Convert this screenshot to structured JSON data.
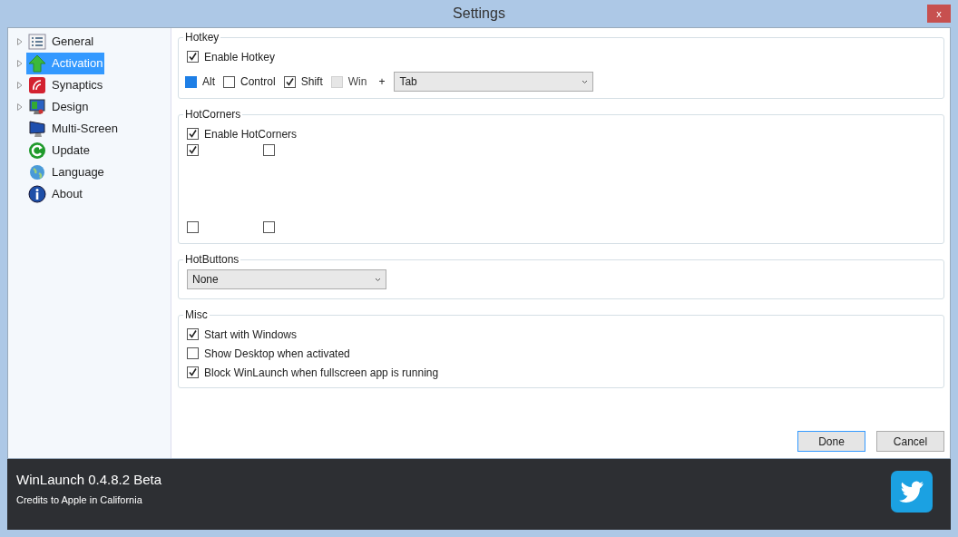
{
  "window": {
    "title": "Settings",
    "close": "x"
  },
  "sidebar": {
    "items": [
      {
        "label": "General",
        "expandable": true,
        "selected": false
      },
      {
        "label": "Activation",
        "expandable": true,
        "selected": true
      },
      {
        "label": "Synaptics",
        "expandable": true,
        "selected": false
      },
      {
        "label": "Design",
        "expandable": true,
        "selected": false
      },
      {
        "label": "Multi-Screen",
        "expandable": false,
        "selected": false
      },
      {
        "label": "Update",
        "expandable": false,
        "selected": false
      },
      {
        "label": "Language",
        "expandable": false,
        "selected": false
      },
      {
        "label": "About",
        "expandable": false,
        "selected": false
      }
    ]
  },
  "hotkey": {
    "title": "Hotkey",
    "enable": {
      "label": "Enable Hotkey",
      "checked": true
    },
    "modifiers": [
      {
        "label": "Alt",
        "checked": false,
        "kind": "highlighted"
      },
      {
        "label": "Control",
        "checked": false,
        "kind": "plain"
      },
      {
        "label": "Shift",
        "checked": true,
        "kind": "plain"
      },
      {
        "label": "Win",
        "checked": false,
        "kind": "disabled"
      }
    ],
    "plus": "+",
    "key": "Tab"
  },
  "hotcorners": {
    "title": "HotCorners",
    "enable": {
      "label": "Enable HotCorners",
      "checked": true
    },
    "corners": [
      {
        "checked": true
      },
      {
        "checked": false
      },
      {
        "checked": false
      },
      {
        "checked": false
      }
    ]
  },
  "hotbuttons": {
    "title": "HotButtons",
    "value": "None"
  },
  "misc": {
    "title": "Misc",
    "options": [
      {
        "label": "Start with Windows",
        "checked": true
      },
      {
        "label": "Show Desktop when activated",
        "checked": false
      },
      {
        "label": "Block WinLaunch when fullscreen app is running",
        "checked": true
      }
    ]
  },
  "buttons": [
    {
      "label": "Done",
      "default": true
    },
    {
      "label": "Cancel",
      "default": false
    }
  ],
  "footer": {
    "title": "WinLaunch 0.4.8.2 Beta",
    "credits": "Credits to Apple in California"
  }
}
